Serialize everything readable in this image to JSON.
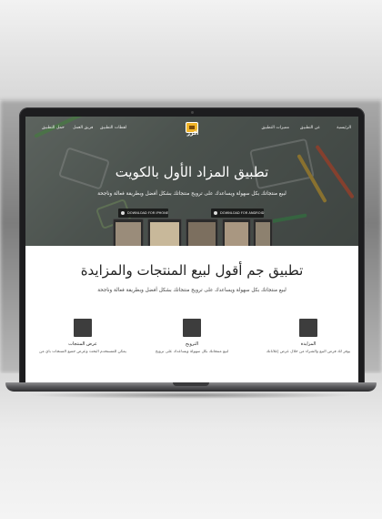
{
  "nav": {
    "items": [
      "الرئيسية",
      "عن التطبيق",
      "مميزات التطبيق",
      "لقطات التطبيق",
      "فريق العمل",
      "حمل التطبيق"
    ],
    "logo_text": "أكزر"
  },
  "hero": {
    "title": "تطبيق المزاد الأول بالكويت",
    "subtitle": "لبيع منتجاتك بكل سهولة ويساعدك على ترويج منتجاتك بشكل أفضل وبطريقة فعالة وناجحة",
    "buttons": [
      {
        "label": "DOWNLOAD FOR IPHONE",
        "icon": "apple-icon"
      },
      {
        "label": "DOWNLOAD FOR ANDROID",
        "icon": "android-icon"
      }
    ]
  },
  "about": {
    "title": "تطبيق جم أقول لبيع المنتجات والمزايدة",
    "subtitle": "لبيع منتجاتك بكل سهولة ويساعدك على ترويج منتجاتك بشكل أفضل وبطريقة فعالة وناجحة"
  },
  "features": [
    {
      "title": "المزايدة",
      "desc": "يوفر لك فرص البيع والشراء من خلال عرض إعلاناتك",
      "icon": "auction-icon"
    },
    {
      "title": "الترويج",
      "desc": "لبيع منتجاتك بكل سهولة ويساعدك على ترويج",
      "icon": "promotion-icon"
    },
    {
      "title": "عرض المنتجات",
      "desc": "يمكن للمستخدم البحث وعرض جميع المنتجات بأي من",
      "icon": "products-icon"
    }
  ],
  "colors": {
    "laptop_body": "#1d1d1f",
    "hero_overlay": "#59625e",
    "logo_accent": "#f0b429",
    "feature_icon": "#3d3d3d"
  }
}
